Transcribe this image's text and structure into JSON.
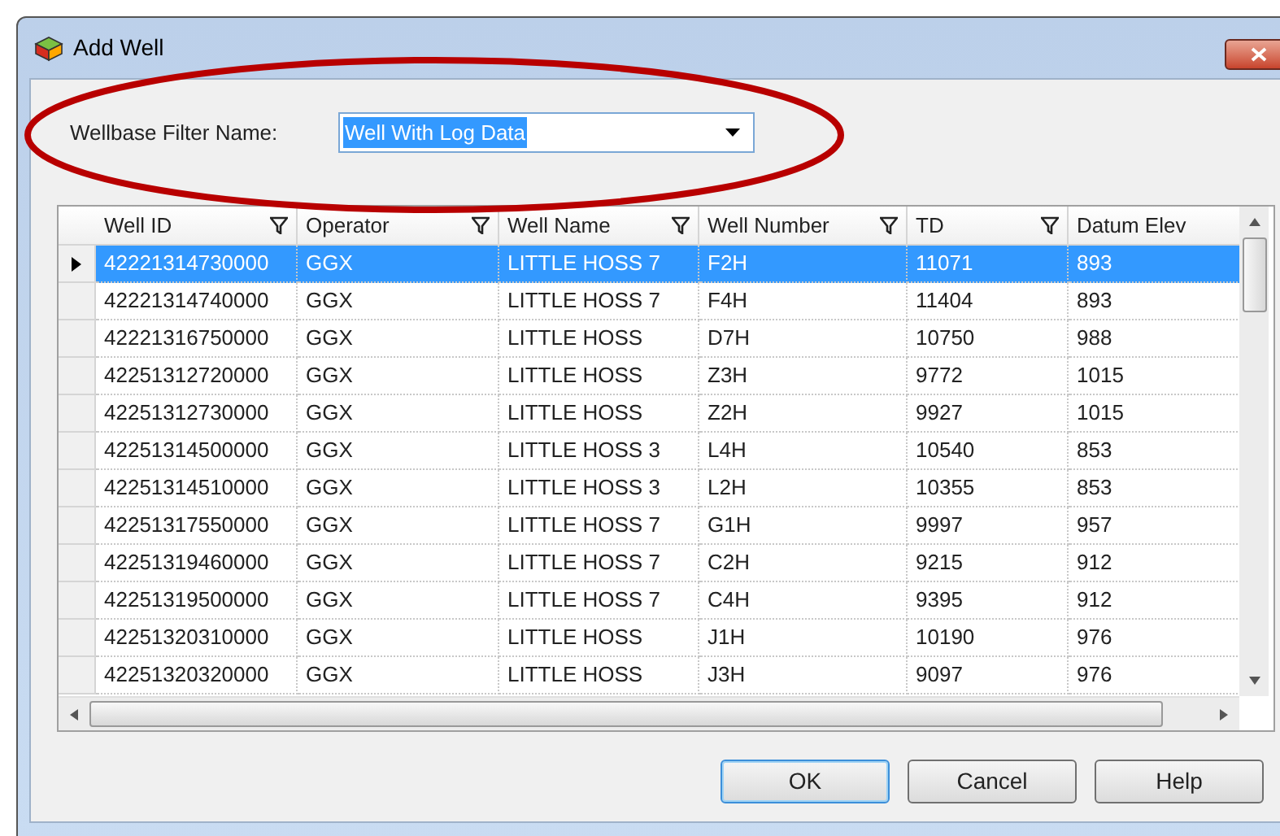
{
  "window": {
    "title": "Add Well"
  },
  "filter": {
    "label": "Wellbase Filter Name:",
    "value": "Well With Log Data",
    "text_selected": true
  },
  "table": {
    "columns": [
      {
        "label": "Well ID",
        "filter": true
      },
      {
        "label": "Operator",
        "filter": true
      },
      {
        "label": "Well Name",
        "filter": true
      },
      {
        "label": "Well Number",
        "filter": true
      },
      {
        "label": "TD",
        "filter": true
      },
      {
        "label": "Datum Elev",
        "filter": false
      }
    ],
    "rows": [
      {
        "selected": true,
        "cells": [
          "42221314730000",
          "GGX",
          "LITTLE HOSS 7",
          "F2H",
          "11071",
          "893"
        ]
      },
      {
        "selected": false,
        "cells": [
          "42221314740000",
          "GGX",
          "LITTLE HOSS 7",
          "F4H",
          "11404",
          "893"
        ]
      },
      {
        "selected": false,
        "cells": [
          "42221316750000",
          "GGX",
          "LITTLE HOSS",
          "D7H",
          "10750",
          "988"
        ]
      },
      {
        "selected": false,
        "cells": [
          "42251312720000",
          "GGX",
          "LITTLE HOSS",
          "Z3H",
          "9772",
          "1015"
        ]
      },
      {
        "selected": false,
        "cells": [
          "42251312730000",
          "GGX",
          "LITTLE HOSS",
          "Z2H",
          "9927",
          "1015"
        ]
      },
      {
        "selected": false,
        "cells": [
          "42251314500000",
          "GGX",
          "LITTLE HOSS 3",
          "L4H",
          "10540",
          "853"
        ]
      },
      {
        "selected": false,
        "cells": [
          "42251314510000",
          "GGX",
          "LITTLE HOSS 3",
          "L2H",
          "10355",
          "853"
        ]
      },
      {
        "selected": false,
        "cells": [
          "42251317550000",
          "GGX",
          "LITTLE HOSS 7",
          "G1H",
          "9997",
          "957"
        ]
      },
      {
        "selected": false,
        "cells": [
          "42251319460000",
          "GGX",
          "LITTLE HOSS 7",
          "C2H",
          "9215",
          "912"
        ]
      },
      {
        "selected": false,
        "cells": [
          "42251319500000",
          "GGX",
          "LITTLE HOSS 7",
          "C4H",
          "9395",
          "912"
        ]
      },
      {
        "selected": false,
        "cells": [
          "42251320310000",
          "GGX",
          "LITTLE HOSS",
          "J1H",
          "10190",
          "976"
        ]
      },
      {
        "selected": false,
        "cells": [
          "42251320320000",
          "GGX",
          "LITTLE HOSS",
          "J3H",
          "9097",
          "976"
        ]
      }
    ]
  },
  "buttons": [
    {
      "label": "OK",
      "default": true
    },
    {
      "label": "Cancel",
      "default": false
    },
    {
      "label": "Help",
      "default": false
    }
  ]
}
